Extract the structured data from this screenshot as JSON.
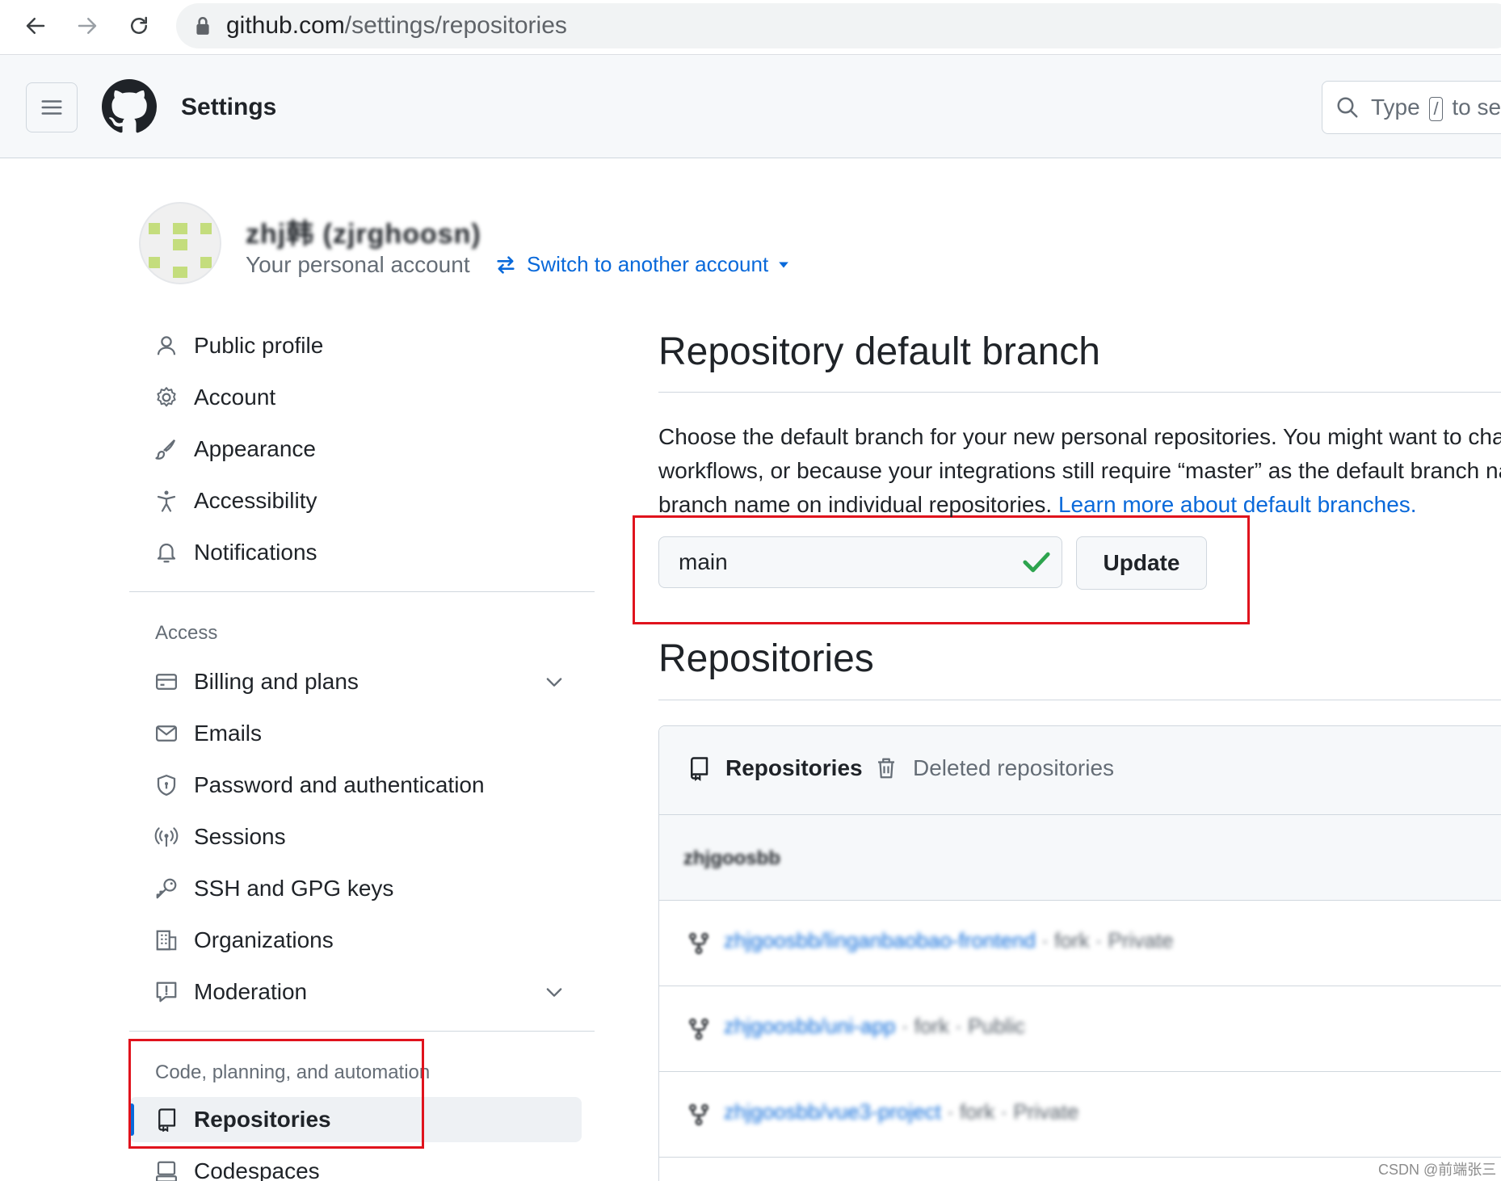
{
  "browser": {
    "url_host": "github.com",
    "url_path": "/settings/repositories"
  },
  "header": {
    "title": "Settings",
    "search_before": "Type",
    "search_key": "/",
    "search_after": "to se"
  },
  "account": {
    "name": "zhj韩 (zjrghoosn)",
    "subtitle": "Your personal account",
    "switch_label": "Switch to another account"
  },
  "sidebar": {
    "items_top": [
      {
        "label": "Public profile",
        "icon": "person-icon"
      },
      {
        "label": "Account",
        "icon": "gear-icon"
      },
      {
        "label": "Appearance",
        "icon": "paintbrush-icon"
      },
      {
        "label": "Accessibility",
        "icon": "accessibility-icon"
      },
      {
        "label": "Notifications",
        "icon": "bell-icon"
      }
    ],
    "access_heading": "Access",
    "items_access": [
      {
        "label": "Billing and plans",
        "icon": "credit-card-icon"
      },
      {
        "label": "Emails",
        "icon": "mail-icon"
      },
      {
        "label": "Password and authentication",
        "icon": "shield-icon"
      },
      {
        "label": "Sessions",
        "icon": "broadcast-icon"
      },
      {
        "label": "SSH and GPG keys",
        "icon": "key-icon"
      },
      {
        "label": "Organizations",
        "icon": "organization-icon"
      },
      {
        "label": "Moderation",
        "icon": "report-icon"
      }
    ],
    "code_heading": "Code, planning, and automation",
    "items_code": [
      {
        "label": "Repositories",
        "icon": "repo-icon",
        "active": true
      },
      {
        "label": "Codespaces",
        "icon": "codespaces-icon"
      }
    ]
  },
  "main": {
    "default_branch_title": "Repository default branch",
    "description_line1": "Choose the default branch for your new personal repositories. You might want to cha",
    "description_line2": "workflows, or because your integrations still require “master” as the default branch na",
    "description_line3": "branch name on individual repositories.",
    "learn_more_link": "Learn more about default branches.",
    "branch_value": "main",
    "update_label": "Update",
    "repositories_title": "Repositories",
    "tabs": [
      {
        "label": "Repositories",
        "icon": "repo-icon",
        "selected": true
      },
      {
        "label": "Deleted repositories",
        "icon": "trash-icon",
        "selected": false
      }
    ],
    "owner_label": "zhjgoosbb",
    "repos": [
      {
        "name": "zhjgoosbb/linganbaobao-frontend",
        "meta": "· fork · Private"
      },
      {
        "name": "zhjgoosbb/uni-app",
        "meta": "· fork · Public"
      },
      {
        "name": "zhjgoosbb/vue3-project",
        "meta": "· fork · Private"
      }
    ]
  },
  "watermark": "CSDN @前端张三",
  "colors": {
    "link": "#0969da",
    "highlight_box": "#e0131d",
    "check": "#2da44e"
  }
}
